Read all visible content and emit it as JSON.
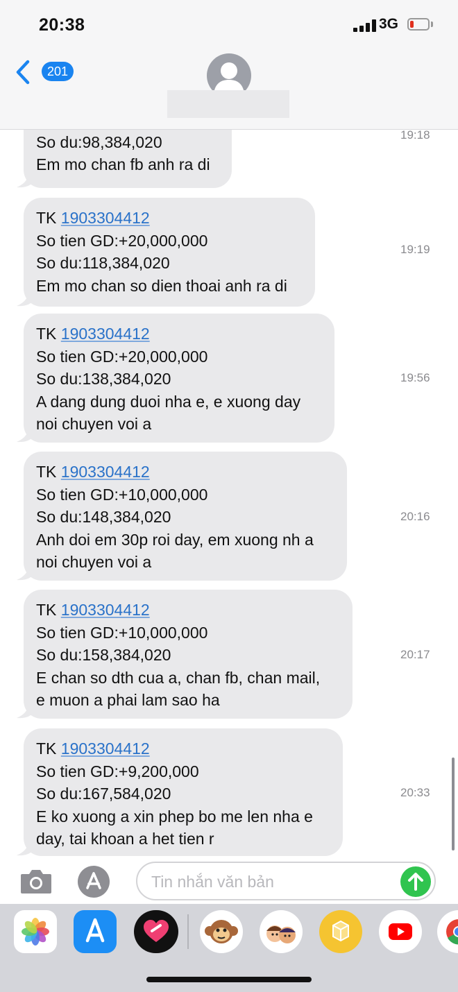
{
  "status_bar": {
    "time": "20:38",
    "network": "3G",
    "battery_level": 0.2
  },
  "header": {
    "back_badge": "201"
  },
  "messages": [
    {
      "lines": [
        "So du:98,384,020",
        "Em mo chan fb anh ra di"
      ],
      "time": "19:18"
    },
    {
      "account_prefix": "TK ",
      "account": "1903304412",
      "lines": [
        "So tien GD:+20,000,000",
        "So du:118,384,020",
        "Em mo chan so dien thoai anh ra di"
      ],
      "time": "19:19"
    },
    {
      "account_prefix": "TK ",
      "account": "1903304412",
      "lines": [
        "So tien GD:+20,000,000",
        "So du:138,384,020",
        "A dang dung duoi nha e, e xuong day",
        "noi chuyen voi a"
      ],
      "time": "19:56"
    },
    {
      "account_prefix": "TK ",
      "account": "1903304412",
      "lines": [
        "So tien GD:+10,000,000",
        "So du:148,384,020",
        "Anh doi em 30p roi day, em xuong nh a",
        "noi chuyen voi a"
      ],
      "time": "20:16"
    },
    {
      "account_prefix": "TK ",
      "account": "1903304412",
      "lines": [
        "So tien GD:+10,000,000",
        "So du:158,384,020",
        "E chan so dth cua a, chan fb, chan mail,",
        "e muon a phai lam sao ha"
      ],
      "time": "20:17"
    },
    {
      "account_prefix": "TK ",
      "account": "1903304412",
      "lines": [
        "So tien GD:+9,200,000",
        "So du:167,584,020",
        "E ko xuong a xin phep bo me len nha e",
        "day, tai khoan a het tien r"
      ],
      "time": "20:33"
    }
  ],
  "composer": {
    "placeholder": "Tin nhắn văn bản",
    "value": ""
  },
  "app_drawer": {
    "apps": [
      {
        "name": "photos-app-icon",
        "bg": "#ffffff"
      },
      {
        "name": "app-store-icon",
        "bg": "#1c8ef5"
      },
      {
        "name": "digital-touch-icon",
        "bg": "#111111"
      },
      {
        "name": "monkey-memoji-icon",
        "bg": "#ffffff"
      },
      {
        "name": "memoji-stickers-icon",
        "bg": "#ffffff"
      },
      {
        "name": "yellow-app-icon",
        "bg": "#f5c431"
      },
      {
        "name": "youtube-icon",
        "bg": "#ffffff"
      },
      {
        "name": "chrome-icon",
        "bg": "#ffffff"
      }
    ]
  }
}
